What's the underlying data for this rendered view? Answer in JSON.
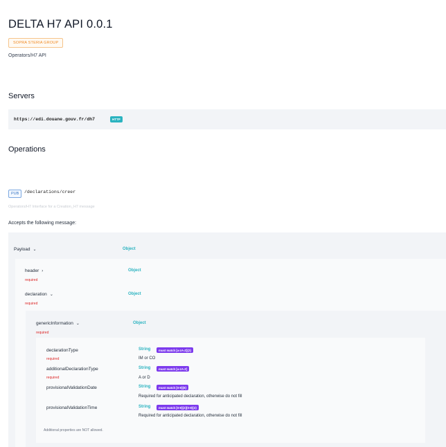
{
  "api": {
    "title": "DELTA H7 API 0.0.1",
    "org": "SOPRA STERIA GROUP",
    "description": "Operators/H7 API"
  },
  "servers": {
    "heading": "Servers",
    "url": "https://edi.douane.gouv.fr/dh7",
    "protocol": "HTTP"
  },
  "operations": {
    "heading": "Operations",
    "op_type": "PUB",
    "path": "/declarations/creer",
    "description": "Operators/H7 Interface for a Creation_H7 message",
    "accepts": "Accepts the following message:"
  },
  "schema": {
    "payload": {
      "name": "Payload",
      "type": "Object",
      "chevron": "⌄"
    },
    "header": {
      "name": "header",
      "type": "Object",
      "required": "required",
      "chevron": "›"
    },
    "declaration": {
      "name": "declaration",
      "type": "Object",
      "required": "required",
      "chevron": "⌄"
    },
    "generic": {
      "name": "genericInformation",
      "type": "Object",
      "required": "required",
      "chevron": "⌄"
    },
    "fields": [
      {
        "name": "declarationType",
        "required": "required",
        "type": "String",
        "pattern": "must match [a-zA-Z]{2}",
        "description": "IM or CO"
      },
      {
        "name": "additionalDeclarationType",
        "required": "required",
        "type": "String",
        "pattern": "must match [a-zA-Z]",
        "description": "A or D"
      },
      {
        "name": "provisionalValidationDate",
        "required": "",
        "type": "String",
        "pattern": "must match [0-9]{8}",
        "description": "Required for anticipated declaration, otherwise do not fill"
      },
      {
        "name": "provisionalValidationTime",
        "required": "",
        "type": "String",
        "pattern": "must match [0-9]{2}[0-9]{2}",
        "description": "Required for anticipated declaration, otherwise do not fill"
      }
    ],
    "additional_note": "Additional properties are NOT allowed."
  },
  "colors": {
    "accent": "#2bb3c0",
    "pattern_badge": "#7c3aed",
    "required": "#dc2626",
    "org_badge": "#f08a24"
  }
}
